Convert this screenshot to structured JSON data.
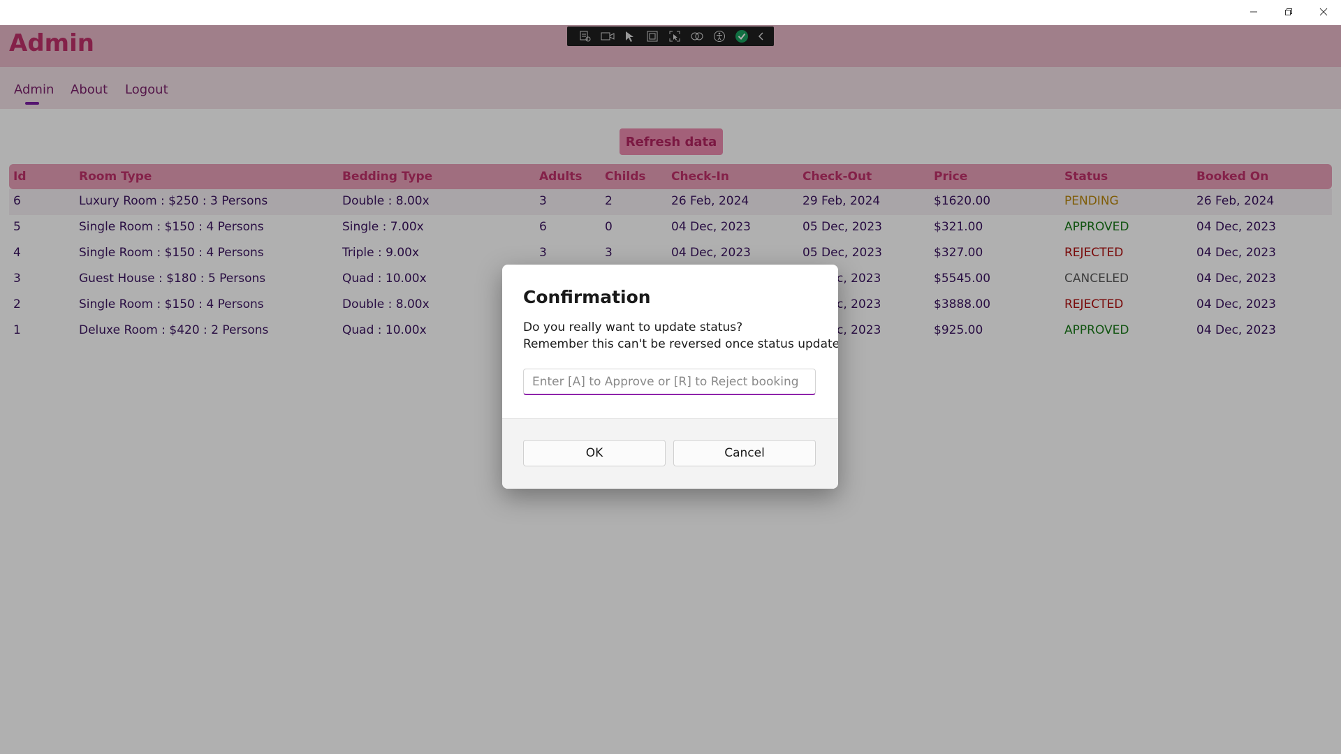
{
  "app": {
    "title": "Admin",
    "nav": [
      {
        "label": "Admin"
      },
      {
        "label": "About"
      },
      {
        "label": "Logout"
      }
    ],
    "refresh_label": "Refresh data"
  },
  "table": {
    "headers": [
      "Id",
      "Room Type",
      "Bedding Type",
      "Adults",
      "Childs",
      "Check-In",
      "Check-Out",
      "Price",
      "Status",
      "Booked On"
    ],
    "rows": [
      {
        "id": "6",
        "room_type": "Luxury Room : $250 : 3 Persons",
        "bedding": "Double : 8.00x",
        "adults": "3",
        "childs": "2",
        "check_in": "26 Feb, 2024",
        "check_out": "29 Feb, 2024",
        "price": "$1620.00",
        "status": "PENDING",
        "status_color": "#b8860b",
        "booked_on": "26 Feb, 2024"
      },
      {
        "id": "5",
        "room_type": "Single Room : $150 : 4 Persons",
        "bedding": "Single : 7.00x",
        "adults": "6",
        "childs": "0",
        "check_in": "04 Dec, 2023",
        "check_out": "05 Dec, 2023",
        "price": "$321.00",
        "status": "APPROVED",
        "status_color": "#1a7a1a",
        "booked_on": "04 Dec, 2023"
      },
      {
        "id": "4",
        "room_type": "Single Room : $150 : 4 Persons",
        "bedding": "Triple : 9.00x",
        "adults": "3",
        "childs": "3",
        "check_in": "04 Dec, 2023",
        "check_out": "05 Dec, 2023",
        "price": "$327.00",
        "status": "REJECTED",
        "status_color": "#b01010",
        "booked_on": "04 Dec, 2023"
      },
      {
        "id": "3",
        "room_type": "Guest House : $180 : 5 Persons",
        "bedding": "Quad : 10.00x",
        "adults": "",
        "childs": "",
        "check_in": "",
        "check_out": "c, 2023",
        "price": "$5545.00",
        "status": "CANCELED",
        "status_color": "#5a5a5a",
        "booked_on": "04 Dec, 2023"
      },
      {
        "id": "2",
        "room_type": "Single Room : $150 : 4 Persons",
        "bedding": "Double : 8.00x",
        "adults": "",
        "childs": "",
        "check_in": "",
        "check_out": "c, 2023",
        "price": "$3888.00",
        "status": "REJECTED",
        "status_color": "#b01010",
        "booked_on": "04 Dec, 2023"
      },
      {
        "id": "1",
        "room_type": "Deluxe Room : $420 : 2 Persons",
        "bedding": "Quad : 10.00x",
        "adults": "",
        "childs": "",
        "check_in": "",
        "check_out": "c, 2023",
        "price": "$925.00",
        "status": "APPROVED",
        "status_color": "#1a7a1a",
        "booked_on": "04 Dec, 2023"
      }
    ]
  },
  "dialog": {
    "title": "Confirmation",
    "message_line1": "Do you really want to update status?",
    "message_line2": "Remember this can't be reversed once status updated!",
    "input_placeholder": "Enter [A] to Approve or [R] to Reject booking",
    "input_value": "",
    "ok_label": "OK",
    "cancel_label": "Cancel"
  },
  "colors": {
    "accent": "#c0306a",
    "header_bg": "#e8b8c8",
    "nav_text": "#7a1f6a",
    "input_underline": "#8e24aa"
  },
  "icons": [
    "minimize-icon",
    "maximize-icon",
    "close-icon",
    "live-visual-tree-icon",
    "record-icon",
    "select-element-icon",
    "display-layout-adorners-icon",
    "track-focus-icon",
    "binding-failures-icon",
    "accessibility-icon",
    "hot-reload-check-icon",
    "collapse-toolbar-icon"
  ]
}
